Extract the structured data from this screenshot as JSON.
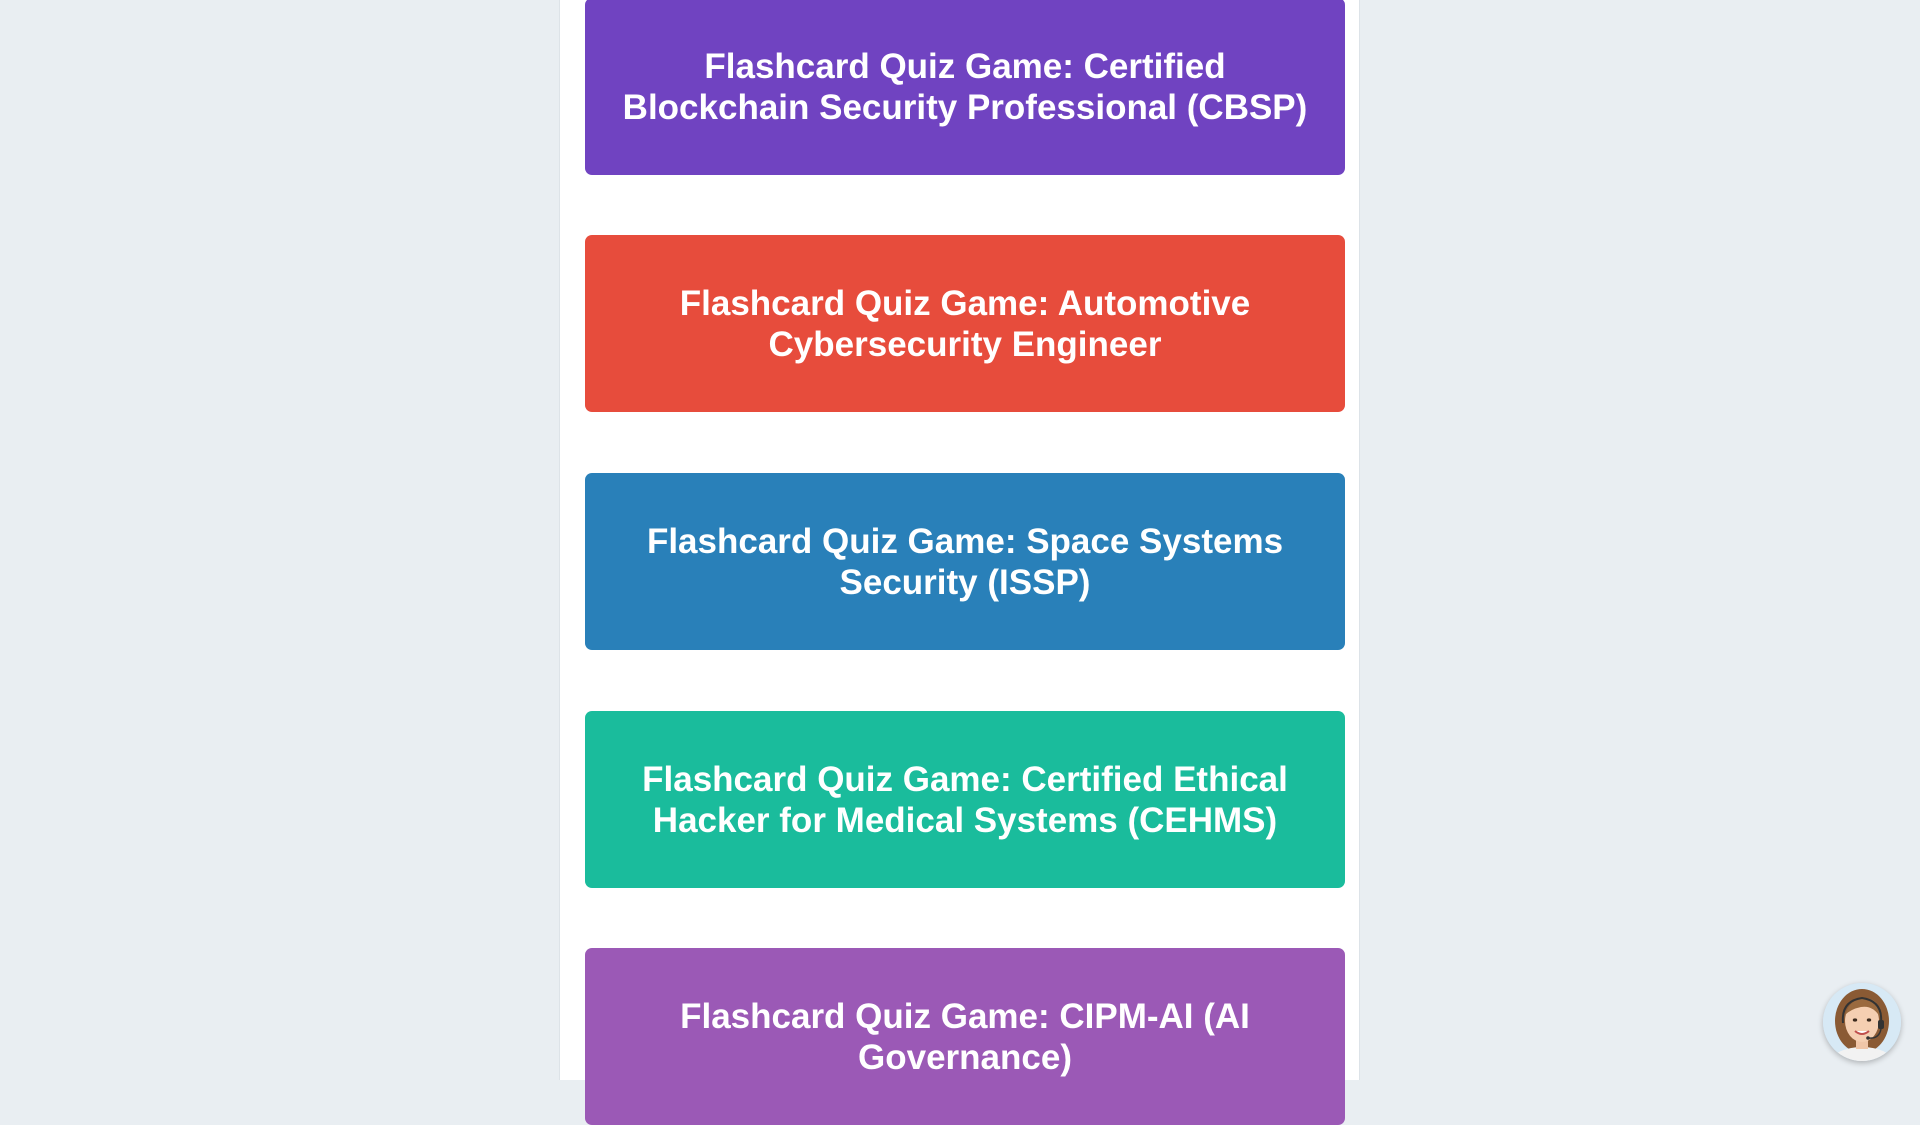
{
  "quiz_cards": [
    {
      "label": "Flashcard Quiz Game: Certified Blockchain Security Professional (CBSP)",
      "color": "#7043c1"
    },
    {
      "label": "Flashcard Quiz Game: Automotive Cybersecurity Engineer",
      "color": "#e74c3c"
    },
    {
      "label": "Flashcard Quiz Game: Space Systems Security (ISSP)",
      "color": "#2980b9"
    },
    {
      "label": "Flashcard Quiz Game: Certified Ethical Hacker for Medical Systems (CEHMS)",
      "color": "#1abc9c"
    },
    {
      "label": "Flashcard Quiz Game: CIPM-AI (AI Governance)",
      "color": "#9b59b6"
    }
  ],
  "chat_widget": {
    "icon": "support-agent-avatar-icon"
  }
}
